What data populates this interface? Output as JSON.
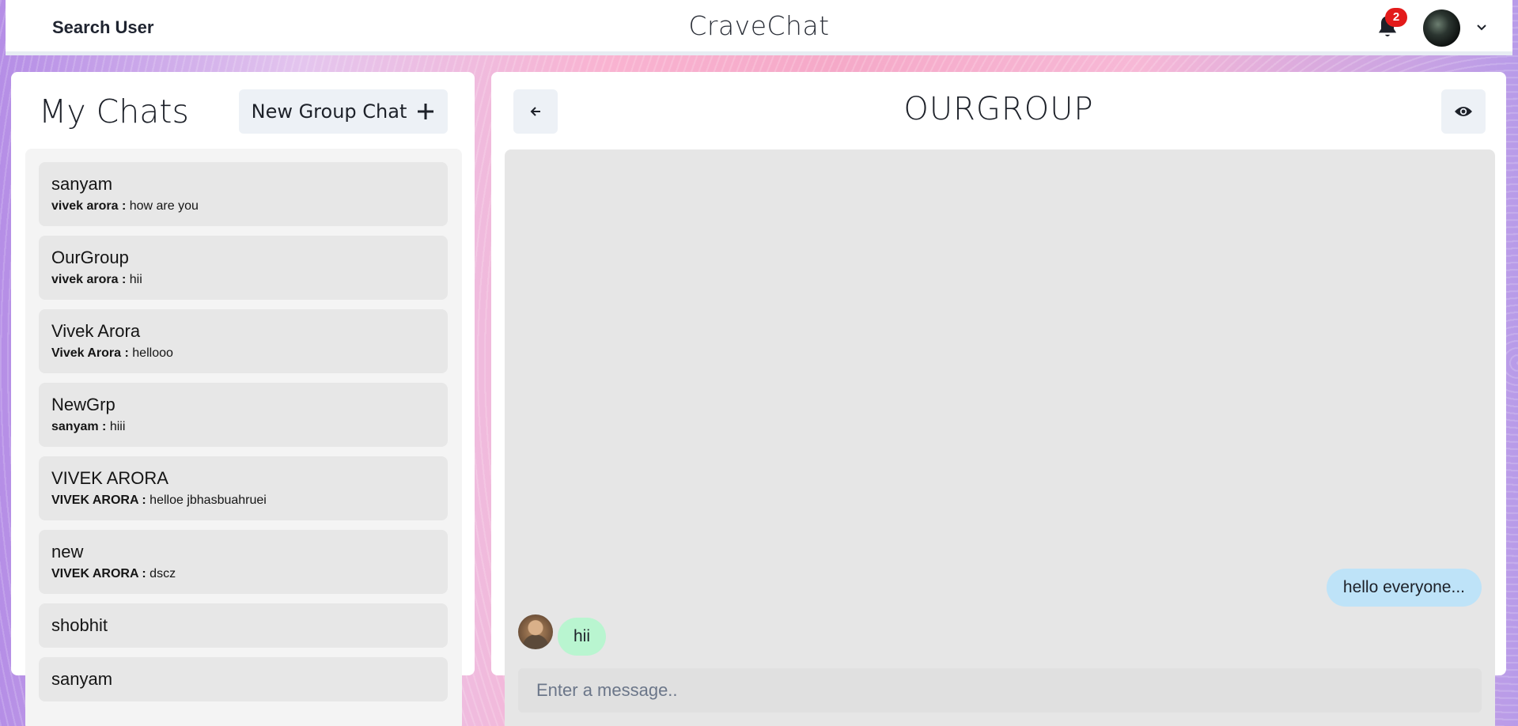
{
  "topbar": {
    "search_label": "Search User",
    "app_title": "CraveChat",
    "notification_count": "2",
    "icons": [
      "bell-icon",
      "avatar",
      "chevron-down-icon"
    ]
  },
  "sidebar": {
    "title": "My Chats",
    "new_group_label": "New Group Chat",
    "chats": [
      {
        "name": "sanyam",
        "sender": "vivek arora :",
        "message": "how are you"
      },
      {
        "name": "OurGroup",
        "sender": "vivek arora :",
        "message": "hii"
      },
      {
        "name": "Vivek Arora",
        "sender": "Vivek Arora :",
        "message": "hellooo"
      },
      {
        "name": "NewGrp",
        "sender": "sanyam :",
        "message": "hiii"
      },
      {
        "name": "VIVEK ARORA",
        "sender": "VIVEK ARORA :",
        "message": "helloe jbhasbuahruei"
      },
      {
        "name": "new",
        "sender": "VIVEK ARORA :",
        "message": "dscz"
      },
      {
        "name": "shobhit"
      },
      {
        "name": "sanyam"
      }
    ]
  },
  "chat": {
    "title": "OURGROUP",
    "messages": [
      {
        "side": "right",
        "text": "hello everyone...",
        "color": "#bee3f8"
      },
      {
        "side": "left",
        "text": "hii",
        "color": "#b9f5d0"
      }
    ],
    "input_placeholder": "Enter a message.."
  },
  "colors": {
    "badge": "#e31b1b",
    "chat_item_bg": "#e7e7e7",
    "messages_bg": "#e6e6e6",
    "button_bg": "#edf1f6"
  }
}
